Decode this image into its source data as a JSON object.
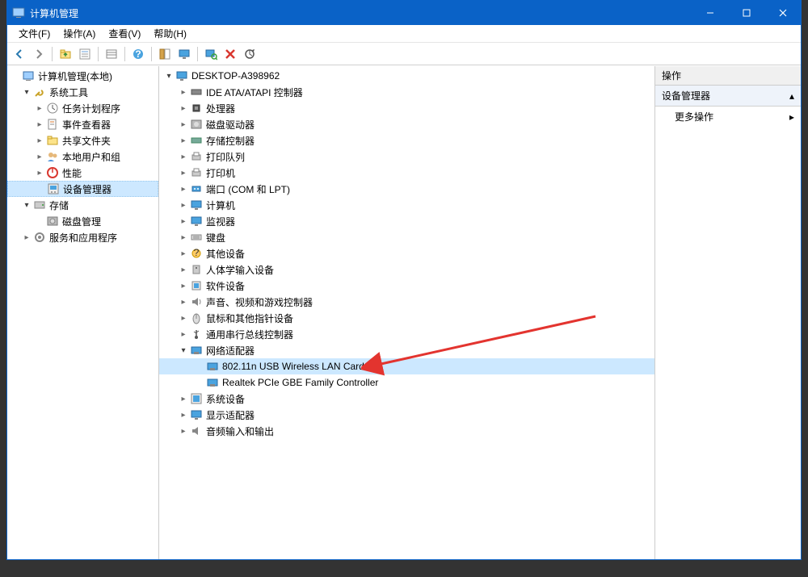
{
  "window": {
    "title": "计算机管理"
  },
  "menubar": [
    "文件(F)",
    "操作(A)",
    "查看(V)",
    "帮助(H)"
  ],
  "toolbar_icons": [
    "back-icon",
    "forward-icon",
    "sep",
    "up-icon",
    "props-icon",
    "sep",
    "list-icon",
    "sep",
    "help-icon",
    "sep",
    "show-hide-icon",
    "monitor-icon",
    "sep",
    "scan-icon",
    "delete-icon",
    "refresh-icon"
  ],
  "left_tree": [
    {
      "label": "计算机管理(本地)",
      "icon": "computer-mgmt-icon",
      "indent": 0,
      "exp": null
    },
    {
      "label": "系统工具",
      "icon": "tools-icon",
      "indent": 1,
      "exp": "open"
    },
    {
      "label": "任务计划程序",
      "icon": "task-icon",
      "indent": 2,
      "exp": "closed"
    },
    {
      "label": "事件查看器",
      "icon": "event-icon",
      "indent": 2,
      "exp": "closed"
    },
    {
      "label": "共享文件夹",
      "icon": "shared-folder-icon",
      "indent": 2,
      "exp": "closed"
    },
    {
      "label": "本地用户和组",
      "icon": "users-icon",
      "indent": 2,
      "exp": "closed"
    },
    {
      "label": "性能",
      "icon": "perf-icon",
      "indent": 2,
      "exp": "closed"
    },
    {
      "label": "设备管理器",
      "icon": "device-mgr-icon",
      "indent": 2,
      "exp": null,
      "selected": true
    },
    {
      "label": "存储",
      "icon": "storage-icon",
      "indent": 1,
      "exp": "open"
    },
    {
      "label": "磁盘管理",
      "icon": "disk-icon",
      "indent": 2,
      "exp": null
    },
    {
      "label": "服务和应用程序",
      "icon": "services-icon",
      "indent": 1,
      "exp": "closed"
    }
  ],
  "center_tree": [
    {
      "label": "DESKTOP-A398962",
      "icon": "pc-icon",
      "indent": 0,
      "exp": "open"
    },
    {
      "label": "IDE ATA/ATAPI 控制器",
      "icon": "ide-icon",
      "indent": 1,
      "exp": "closed"
    },
    {
      "label": "处理器",
      "icon": "cpu-icon",
      "indent": 1,
      "exp": "closed"
    },
    {
      "label": "磁盘驱动器",
      "icon": "hdd-icon",
      "indent": 1,
      "exp": "closed"
    },
    {
      "label": "存储控制器",
      "icon": "storage-ctrl-icon",
      "indent": 1,
      "exp": "closed"
    },
    {
      "label": "打印队列",
      "icon": "print-queue-icon",
      "indent": 1,
      "exp": "closed"
    },
    {
      "label": "打印机",
      "icon": "printer-icon",
      "indent": 1,
      "exp": "closed"
    },
    {
      "label": "端口 (COM 和 LPT)",
      "icon": "port-icon",
      "indent": 1,
      "exp": "closed"
    },
    {
      "label": "计算机",
      "icon": "computer-icon",
      "indent": 1,
      "exp": "closed"
    },
    {
      "label": "监视器",
      "icon": "monitor-type-icon",
      "indent": 1,
      "exp": "closed"
    },
    {
      "label": "键盘",
      "icon": "keyboard-icon",
      "indent": 1,
      "exp": "closed"
    },
    {
      "label": "其他设备",
      "icon": "other-icon",
      "indent": 1,
      "exp": "closed"
    },
    {
      "label": "人体学输入设备",
      "icon": "hid-icon",
      "indent": 1,
      "exp": "closed"
    },
    {
      "label": "软件设备",
      "icon": "software-icon",
      "indent": 1,
      "exp": "closed"
    },
    {
      "label": "声音、视频和游戏控制器",
      "icon": "sound-icon",
      "indent": 1,
      "exp": "closed"
    },
    {
      "label": "鼠标和其他指针设备",
      "icon": "mouse-icon",
      "indent": 1,
      "exp": "closed"
    },
    {
      "label": "通用串行总线控制器",
      "icon": "usb-icon",
      "indent": 1,
      "exp": "closed"
    },
    {
      "label": "网络适配器",
      "icon": "network-icon",
      "indent": 1,
      "exp": "open"
    },
    {
      "label": "802.11n USB Wireless LAN Card",
      "icon": "nic-icon",
      "indent": 2,
      "exp": null,
      "selected": true
    },
    {
      "label": "Realtek PCIe GBE Family Controller",
      "icon": "nic-icon",
      "indent": 2,
      "exp": null
    },
    {
      "label": "系统设备",
      "icon": "system-icon",
      "indent": 1,
      "exp": "closed"
    },
    {
      "label": "显示适配器",
      "icon": "display-icon",
      "indent": 1,
      "exp": "closed"
    },
    {
      "label": "音频输入和输出",
      "icon": "audio-io-icon",
      "indent": 1,
      "exp": "closed"
    }
  ],
  "actions": {
    "header": "操作",
    "section": "设备管理器",
    "more": "更多操作"
  }
}
